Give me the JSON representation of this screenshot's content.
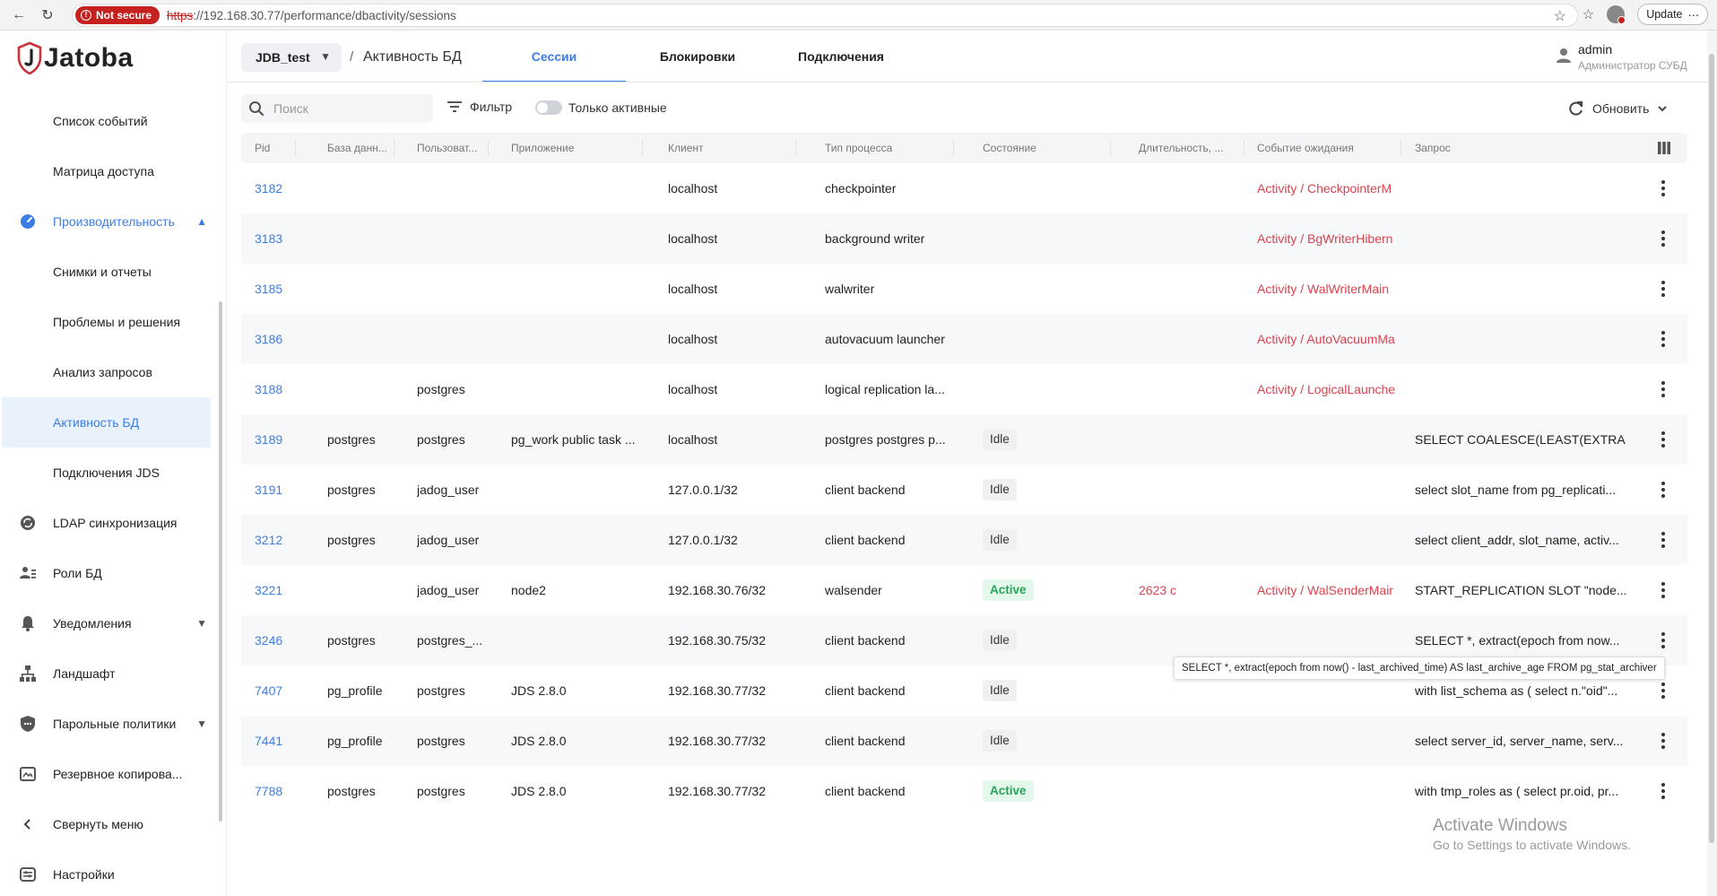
{
  "browser": {
    "not_secure": "Not secure",
    "url_scheme": "https",
    "url_rest": "://192.168.30.77/performance/dbactivity/sessions",
    "update_label": "Update"
  },
  "sidebar": {
    "logo_text": "Jatoba",
    "items": [
      {
        "label": "Список событий",
        "icon": "none"
      },
      {
        "label": "Матрица доступа",
        "icon": "none"
      },
      {
        "label": "Производительность",
        "icon": "gauge-icon"
      },
      {
        "label": "Снимки и отчеты",
        "icon": "none"
      },
      {
        "label": "Проблемы и решения",
        "icon": "none"
      },
      {
        "label": "Анализ запросов",
        "icon": "none"
      },
      {
        "label": "Активность БД",
        "icon": "none"
      },
      {
        "label": "Подключения JDS",
        "icon": "none"
      },
      {
        "label": "LDAP синхронизация",
        "icon": "sync-icon"
      },
      {
        "label": "Роли БД",
        "icon": "roles-icon"
      },
      {
        "label": "Уведомления",
        "icon": "bell-icon"
      },
      {
        "label": "Ландшафт",
        "icon": "landscape-icon"
      },
      {
        "label": "Парольные политики",
        "icon": "shield-icon"
      },
      {
        "label": "Резервное копирова...",
        "icon": "backup-icon"
      },
      {
        "label": "Свернуть меню",
        "icon": "chevron-left-icon"
      },
      {
        "label": "Настройки",
        "icon": "settings-icon"
      }
    ]
  },
  "header": {
    "db_name": "JDB_test",
    "separator": "/",
    "title": "Активность БД",
    "tabs": [
      "Сессии",
      "Блокировки",
      "Подключения"
    ],
    "user_name": "admin",
    "user_role": "Администратор СУБД"
  },
  "toolbar": {
    "search_placeholder": "Поиск",
    "filter_label": "Фильтр",
    "toggle_label": "Только активные",
    "refresh_label": "Обновить"
  },
  "table": {
    "columns": [
      "Pid",
      "База данн...",
      "Пользоват...",
      "Приложение",
      "Клиент",
      "Тип процесса",
      "Состояние",
      "Длительность, ...",
      "Событие ожидания",
      "Запрос"
    ],
    "rows": [
      {
        "pid": "3182",
        "db": "",
        "user": "",
        "app": "",
        "client": "localhost",
        "type": "checkpointer",
        "state": "",
        "duration": "",
        "wait": "Activity / CheckpointerM",
        "query": ""
      },
      {
        "pid": "3183",
        "db": "",
        "user": "",
        "app": "",
        "client": "localhost",
        "type": "background writer",
        "state": "",
        "duration": "",
        "wait": "Activity / BgWriterHibern",
        "query": ""
      },
      {
        "pid": "3185",
        "db": "",
        "user": "",
        "app": "",
        "client": "localhost",
        "type": "walwriter",
        "state": "",
        "duration": "",
        "wait": "Activity / WalWriterMain",
        "query": ""
      },
      {
        "pid": "3186",
        "db": "",
        "user": "",
        "app": "",
        "client": "localhost",
        "type": "autovacuum launcher",
        "state": "",
        "duration": "",
        "wait": "Activity / AutoVacuumMa",
        "query": ""
      },
      {
        "pid": "3188",
        "db": "",
        "user": "postgres",
        "app": "",
        "client": "localhost",
        "type": "logical replication la...",
        "state": "",
        "duration": "",
        "wait": "Activity / LogicalLaunche",
        "query": ""
      },
      {
        "pid": "3189",
        "db": "postgres",
        "user": "postgres",
        "app": "pg_work public task ...",
        "client": "localhost",
        "type": "postgres postgres p...",
        "state": "Idle",
        "duration": "",
        "wait": "",
        "query": "SELECT COALESCE(LEAST(EXTRA..."
      },
      {
        "pid": "3191",
        "db": "postgres",
        "user": "jadog_user",
        "app": "",
        "client": "127.0.0.1/32",
        "type": "client backend",
        "state": "Idle",
        "duration": "",
        "wait": "",
        "query": "select slot_name from pg_replicati..."
      },
      {
        "pid": "3212",
        "db": "postgres",
        "user": "jadog_user",
        "app": "",
        "client": "127.0.0.1/32",
        "type": "client backend",
        "state": "Idle",
        "duration": "",
        "wait": "",
        "query": "select client_addr, slot_name, activ..."
      },
      {
        "pid": "3221",
        "db": "",
        "user": "jadog_user",
        "app": "node2",
        "client": "192.168.30.76/32",
        "type": "walsender",
        "state": "Active",
        "duration": "2623 с",
        "wait": "Activity / WalSenderMair",
        "query": "START_REPLICATION SLOT \"node..."
      },
      {
        "pid": "3246",
        "db": "postgres",
        "user": "postgres_...",
        "app": "",
        "client": "192.168.30.75/32",
        "type": "client backend",
        "state": "Idle",
        "duration": "",
        "wait": "",
        "query": "SELECT *, extract(epoch from now..."
      },
      {
        "pid": "7407",
        "db": "pg_profile",
        "user": "postgres",
        "app": "JDS 2.8.0",
        "client": "192.168.30.77/32",
        "type": "client backend",
        "state": "Idle",
        "duration": "",
        "wait": "",
        "query": "with list_schema as ( select n.\"oid\"..."
      },
      {
        "pid": "7441",
        "db": "pg_profile",
        "user": "postgres",
        "app": "JDS 2.8.0",
        "client": "192.168.30.77/32",
        "type": "client backend",
        "state": "Idle",
        "duration": "",
        "wait": "",
        "query": "select server_id, server_name, serv..."
      },
      {
        "pid": "7788",
        "db": "postgres",
        "user": "postgres",
        "app": "JDS 2.8.0",
        "client": "192.168.30.77/32",
        "type": "client backend",
        "state": "Active",
        "duration": "",
        "wait": "",
        "query": "with tmp_roles as ( select pr.oid, pr..."
      }
    ],
    "tooltip": "SELECT *, extract(epoch from now() - last_archived_time) AS last_archive_age FROM pg_stat_archiver"
  },
  "watermark": {
    "line1": "Activate Windows",
    "line2": "Go to Settings to activate Windows."
  },
  "colors": {
    "accent": "#3d7ee6",
    "wait_red": "#d9434e",
    "active_green": "#27a55a"
  }
}
